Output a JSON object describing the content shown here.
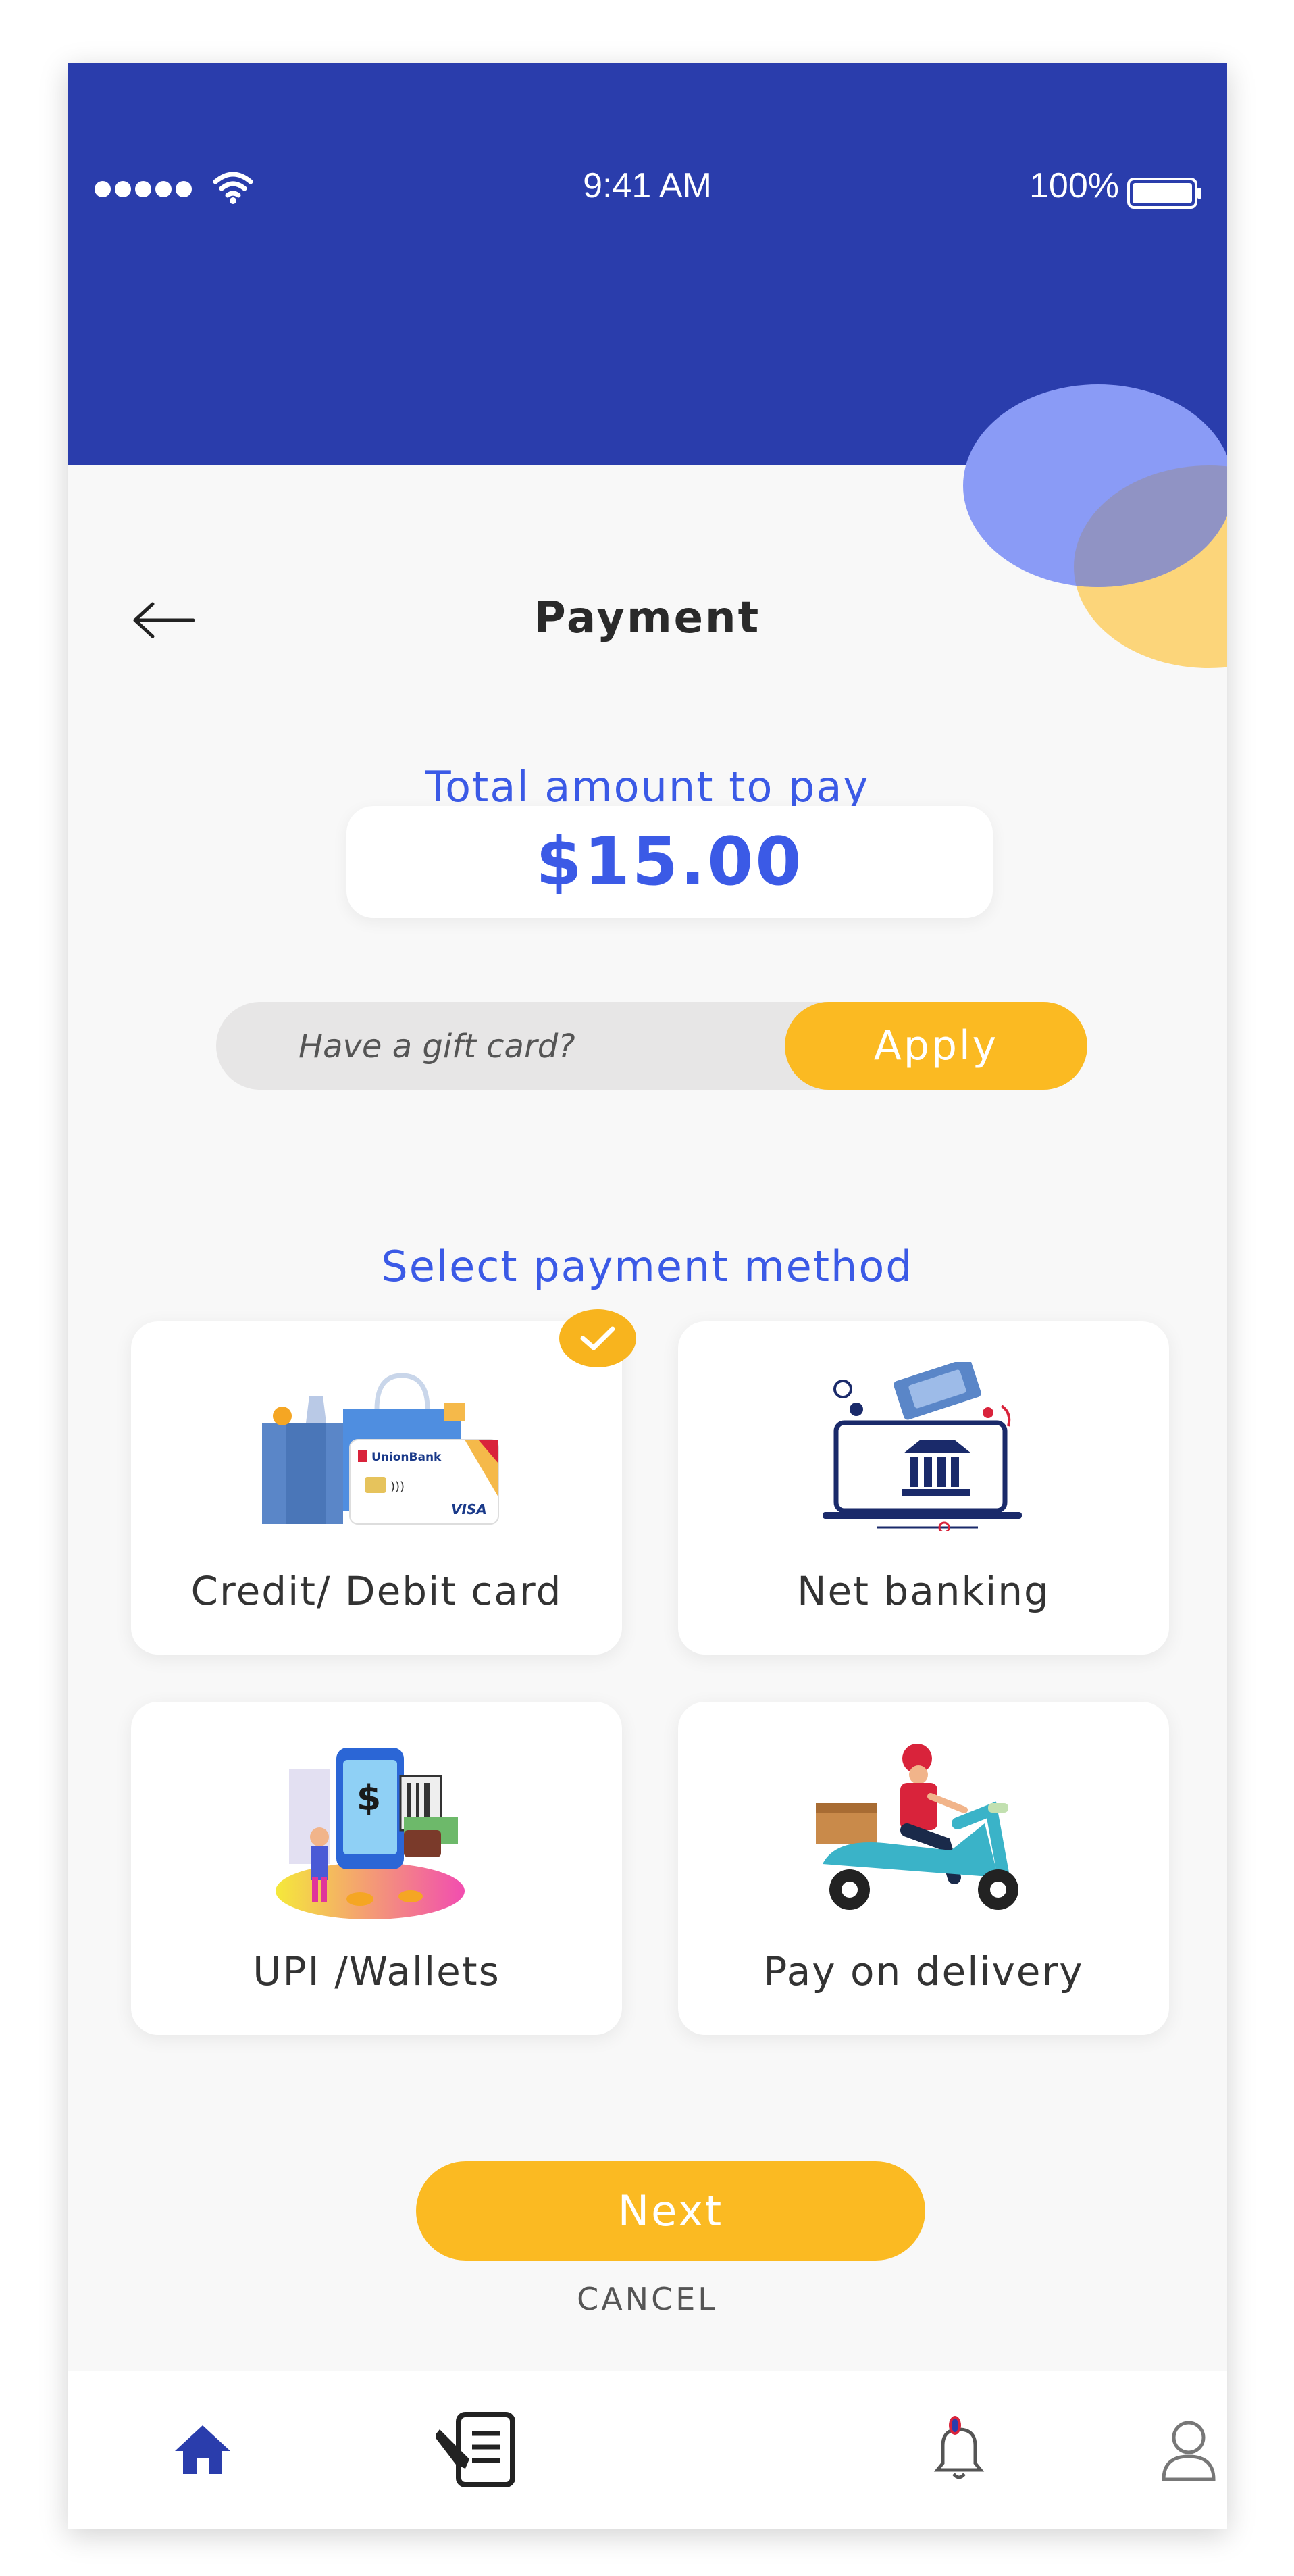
{
  "status_bar": {
    "time": "9:41 AM",
    "battery": "100%",
    "signal_icon": "signal-dots-icon",
    "wifi_icon": "wifi-icon",
    "battery_icon": "battery-icon"
  },
  "header": {
    "title": "Payment",
    "back_icon": "arrow-left-icon"
  },
  "total": {
    "label": "Total amount to pay",
    "amount": "$15.00"
  },
  "gift_card": {
    "placeholder": "Have a gift card?",
    "apply_label": "Apply"
  },
  "methods": {
    "label": "Select payment method",
    "items": [
      {
        "label": "Credit/ Debit card",
        "selected": true,
        "card_brand": "UnionBank",
        "card_network": "VISA"
      },
      {
        "label": "Net banking",
        "selected": false
      },
      {
        "label": "UPI /Wallets",
        "selected": false
      },
      {
        "label": "Pay on delivery",
        "selected": false
      }
    ]
  },
  "actions": {
    "next_label": "Next",
    "cancel_label": "CANCEL"
  },
  "tab_bar": {
    "items": [
      "home-icon",
      "orders-edit-icon",
      "notification-bell-icon",
      "profile-icon"
    ]
  },
  "colors": {
    "header_blue": "#2a3dac",
    "accent_blue": "#3b5ae6",
    "accent_yellow": "#fbba22",
    "background": "#f8f8f8"
  }
}
